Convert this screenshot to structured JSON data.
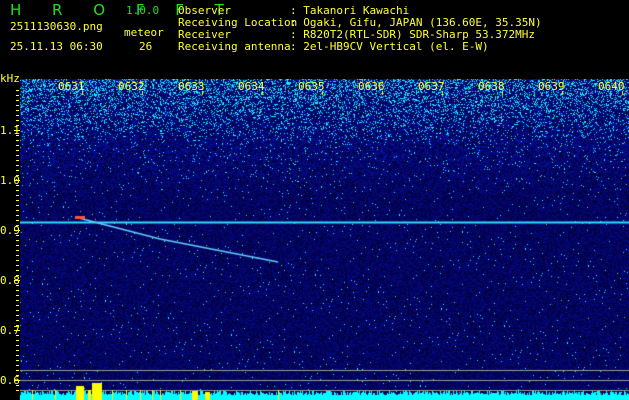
{
  "app": {
    "name": "H R O F F T",
    "version": "1.0.0"
  },
  "file": {
    "name": "2511130630.png",
    "datetime": "25.11.13 06:30"
  },
  "meteor": {
    "label": "meteor",
    "count": "26"
  },
  "info": [
    {
      "label": "Observer",
      "value": ": Takanori Kawachi"
    },
    {
      "label": "Receiving Location",
      "value": ": Ogaki, Gifu, JAPAN (136.60E, 35.35N)"
    },
    {
      "label": "Receiver",
      "value": ": R820T2(RTL-SDR) SDR-Sharp 53.372MHz"
    },
    {
      "label": "Receiving antenna",
      "value": ": 2el-HB9CV Vertical (el. E-W)"
    }
  ],
  "chart_data": {
    "type": "heatmap",
    "ylabel": "kHz",
    "y_ticks": [
      "1.1",
      "1.0",
      "0.9",
      "0.8",
      "0.7",
      "0.6"
    ],
    "x_ticks": [
      "0631",
      "0632",
      "0633",
      "0634",
      "0635",
      "0636",
      "0637",
      "0638",
      "0639",
      "0640"
    ],
    "ylim": [
      0.56,
      1.2
    ],
    "carrier_khz": 0.917,
    "colors": {
      "background": "#000000",
      "low": "#0a1a88",
      "high": "#33ccff",
      "carrier": "#33ddff",
      "text": "#ffff33",
      "activity_bar": "#00ffff",
      "meteor_bar": "#ffff00"
    }
  }
}
